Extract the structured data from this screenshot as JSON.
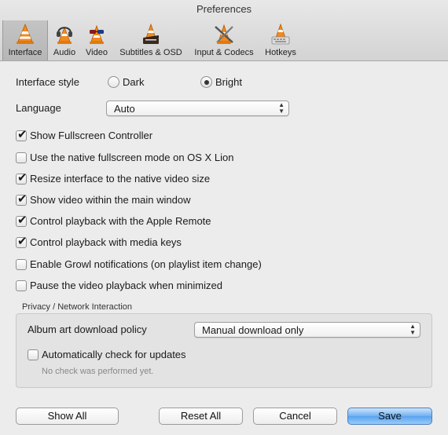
{
  "window": {
    "title": "Preferences"
  },
  "tabs": [
    {
      "label": "Interface",
      "icon": "vlc-cone-icon",
      "active": true
    },
    {
      "label": "Audio",
      "icon": "headphones-cone-icon",
      "active": false
    },
    {
      "label": "Video",
      "icon": "glasses-cone-icon",
      "active": false
    },
    {
      "label": "Subtitles & OSD",
      "icon": "clapperboard-cone-icon",
      "active": false
    },
    {
      "label": "Input & Codecs",
      "icon": "tools-cone-icon",
      "active": false
    },
    {
      "label": "Hotkeys",
      "icon": "keyboard-cone-icon",
      "active": false
    }
  ],
  "interface_style": {
    "label": "Interface style",
    "options": [
      {
        "label": "Dark",
        "selected": false
      },
      {
        "label": "Bright",
        "selected": true
      }
    ]
  },
  "language": {
    "label": "Language",
    "value": "Auto"
  },
  "checkboxes": [
    {
      "label": "Show Fullscreen Controller",
      "checked": true
    },
    {
      "label": "Use the native fullscreen mode on OS X Lion",
      "checked": false
    },
    {
      "label": "Resize interface to the native video size",
      "checked": true
    },
    {
      "label": "Show video within the main window",
      "checked": true
    },
    {
      "label": "Control playback with the Apple Remote",
      "checked": true
    },
    {
      "label": "Control playback with media keys",
      "checked": true
    },
    {
      "label": "Enable Growl notifications (on playlist item change)",
      "checked": false
    },
    {
      "label": "Pause the video playback when minimized",
      "checked": false
    }
  ],
  "privacy": {
    "title": "Privacy / Network Interaction",
    "album_art": {
      "label": "Album art download policy",
      "value": "Manual download only"
    },
    "auto_update": {
      "label": "Automatically check for updates",
      "checked": false
    },
    "hint": "No check was performed yet."
  },
  "buttons": {
    "show_all": "Show All",
    "reset_all": "Reset All",
    "cancel": "Cancel",
    "save": "Save"
  },
  "check_glyph": "✔"
}
